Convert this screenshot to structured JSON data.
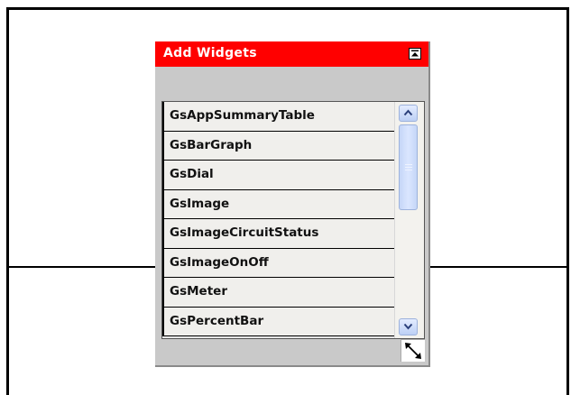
{
  "panel": {
    "title": "Add Widgets"
  },
  "widgets": {
    "items": [
      "GsAppSummaryTable",
      "GsBarGraph",
      "GsDial",
      "GsImage",
      "GsImageCircuitStatus",
      "GsImageOnOff",
      "GsMeter",
      "GsPercentBar"
    ]
  },
  "colors": {
    "title_bar": "#ff0000",
    "panel_background": "#c9c9c9",
    "scrollbar_accent": "#bdd0f5"
  },
  "icons": {
    "collapse": "collapse-up-icon",
    "scroll_up": "chevron-up-icon",
    "scroll_down": "chevron-down-icon",
    "resize": "resize-diagonal-icon"
  }
}
